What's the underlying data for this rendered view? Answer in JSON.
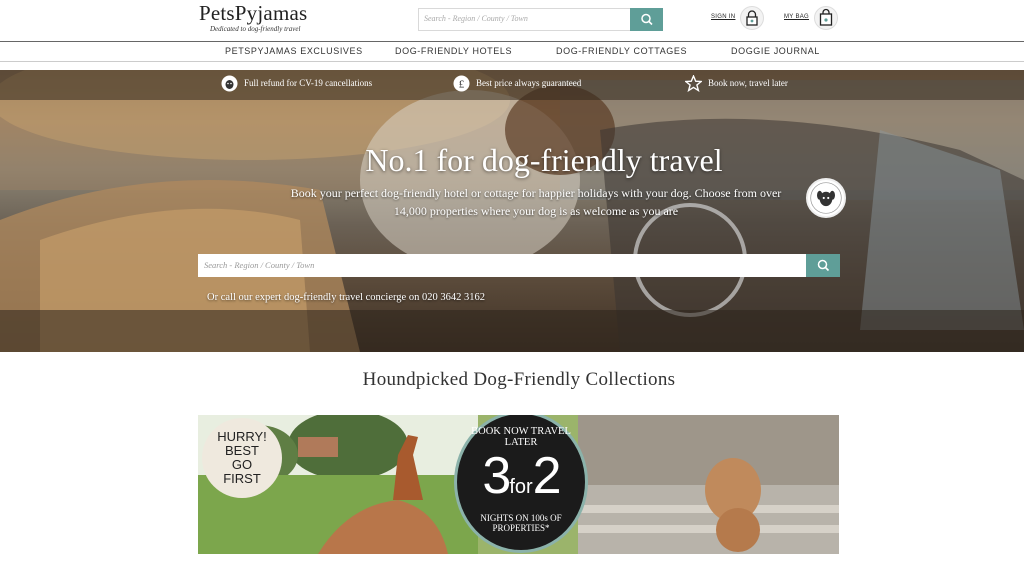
{
  "header": {
    "logo_name": "PetsPyjamas",
    "logo_tagline": "Dedicated to dog-friendly travel",
    "search_placeholder": "Search - Region / County / Town",
    "sign_in": "SIGN IN",
    "my_bag": "MY BAG"
  },
  "nav": [
    {
      "label": "PETSPYJAMAS EXCLUSIVES"
    },
    {
      "label": "DOG-FRIENDLY HOTELS"
    },
    {
      "label": "DOG-FRIENDLY COTTAGES"
    },
    {
      "label": "DOGGIE JOURNAL"
    }
  ],
  "hero": {
    "trust_items": [
      {
        "icon": "dog-badge-icon",
        "label": "Full refund for CV-19 cancellations"
      },
      {
        "icon": "pound-icon",
        "label": "Best price always guaranteed"
      },
      {
        "icon": "star-icon",
        "label": "Book now, travel later"
      }
    ],
    "title": "No.1 for dog-friendly travel",
    "subtitle": "Book your perfect dog-friendly hotel or cottage for happier holidays with your dog. Choose from over 14,000 properties where your dog is as welcome as you are",
    "search_placeholder": "Search - Region / County / Town",
    "call_text": "Or call our expert dog-friendly travel concierge on 020 3642 3162"
  },
  "collections": {
    "title": "Houndpicked Dog-Friendly Collections",
    "hurry_lines": [
      "HURRY!",
      "BEST",
      "GO",
      "FIRST"
    ],
    "offer_top": "BOOK NOW TRAVEL LATER",
    "offer_main_left": "3",
    "offer_main_mid": "for",
    "offer_main_right": "2",
    "offer_bottom": "NIGHTS ON 100s OF PROPERTIES*"
  },
  "colors": {
    "accent": "#5f9e98",
    "text": "#333333"
  }
}
